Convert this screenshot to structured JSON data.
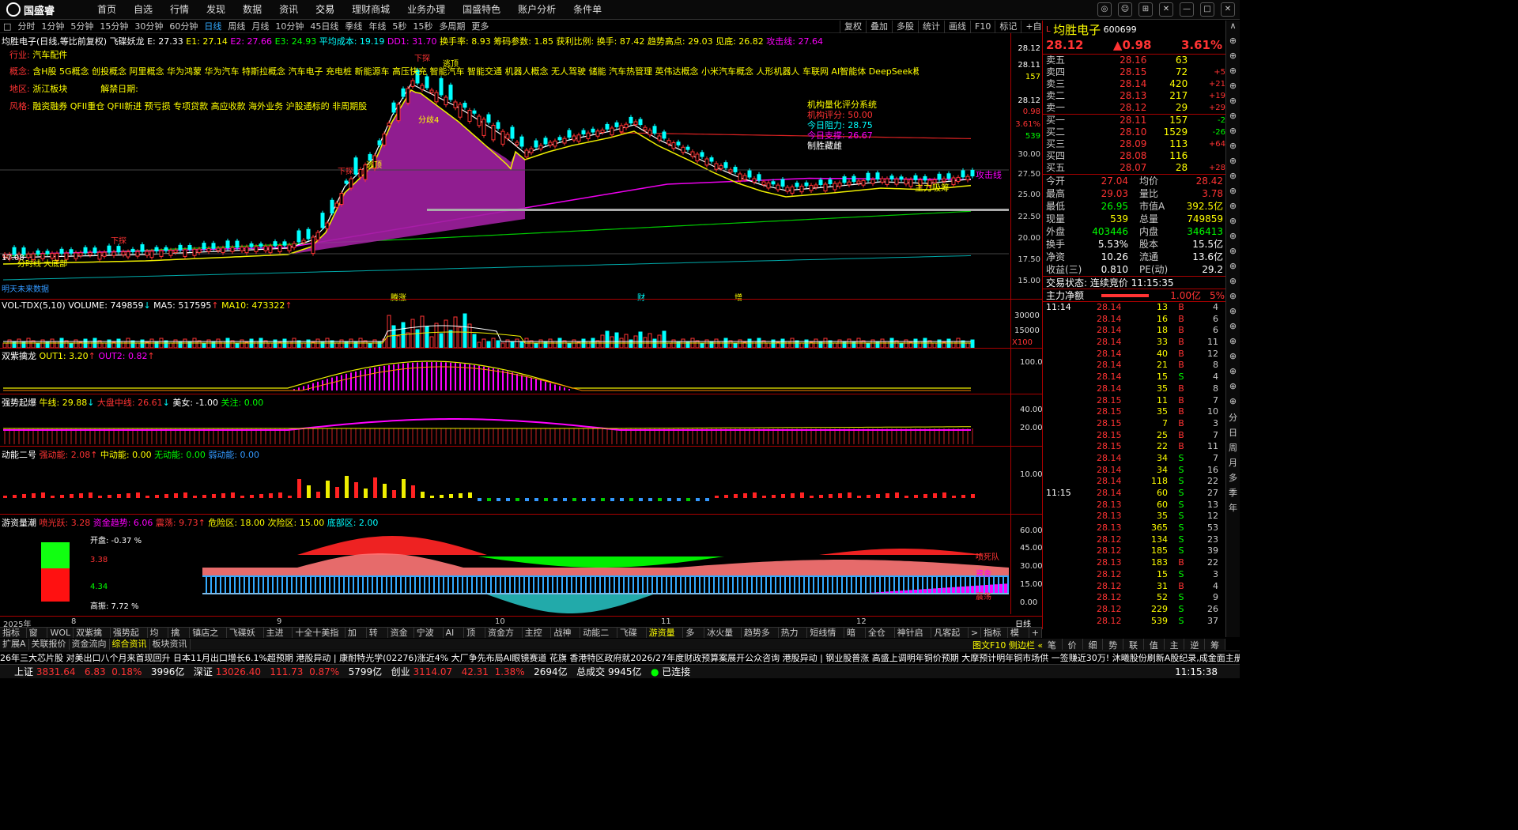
{
  "app": {
    "logo_text": "国盛睿",
    "menu": [
      "首页",
      "自选",
      "行情",
      "发现",
      "数据",
      "资讯",
      "交易",
      "理财商城",
      "业务办理",
      "国盛特色",
      "账户分析",
      "条件单"
    ],
    "window_icons": [
      "chat-icon",
      "user-icon",
      "grid-icon",
      "min",
      "max",
      "close"
    ]
  },
  "period_bar": [
    "□",
    "分时",
    "1分钟",
    "5分钟",
    "15分钟",
    "30分钟",
    "60分钟",
    "日线",
    "周线",
    "月线",
    "10分钟",
    "45日线",
    "季线",
    "年线",
    "5秒",
    "15秒",
    "多周期",
    "更多"
  ],
  "period_selected": "日线",
  "tool_buttons": [
    "复权",
    "叠加",
    "多股",
    "统计",
    "画线",
    "F10",
    "标记",
    "+自选",
    "返回"
  ],
  "main_header": {
    "name": "均胜电子(日线,等比前复权)",
    "indicator": "飞碟妖龙",
    "E": "E: 27.33",
    "E1": "E1: 27.14",
    "E2": "E2: 27.66",
    "E3": "E3: 24.93",
    "avg_cost": "平均成本: 19.19",
    "dd1": "DD1: 31.70",
    "turnover_rate": "换手率: 8.93",
    "chip": "筹码参数: 1.85",
    "profit": "获利比例:",
    "hand": "换手: 87.42",
    "trend_high": "趋势高点: 29.03",
    "low_line": "见底: 26.82",
    "attack": "攻击线: 27.64"
  },
  "stock_info": {
    "industry_label": "行业:",
    "industry": "汽车配件",
    "concept_label": "概念:",
    "concept": "含H股 5G概念 创投概念 阿里概念 华为鸿蒙 华为汽车 特斯拉概念 汽车电子 充电桩 新能源车 高压快充 智能汽车 智能交通 机器人概念 无人驾驶 储能 汽车热管理 英伟达概念 小米汽车概念 人形机器人 车联网 AI智能体 DeepSeek概念",
    "region_label": "地区:",
    "region": "浙江板块",
    "ban_label": "解禁日期:",
    "style_label": "风格:",
    "style": "融资融券 QFII重仓 QFII新进 预亏损 专项贷款 高应收款 海外业务 沪股通标的 非周期股"
  },
  "score_box": {
    "title": "机构量化评分系统",
    "score": "机构评分: 50.00",
    "resist": "今日阻力: 28.75",
    "support": "今日支撑: 26.67",
    "verdict": "制胜藏雌"
  },
  "main_chart_labels": {
    "high_mark": "高点",
    "low_mark": "17.08",
    "breakout": "下探",
    "main_force": "主力吸筹",
    "attack_line": "攻击线",
    "bottom_left": "分时线 大底部",
    "future": "明天未来数据",
    "sub_labels": [
      "腾涨",
      "财",
      "增"
    ],
    "tags": [
      "下探",
      "妖龙",
      "龙",
      "逃顶",
      "分歧4"
    ]
  },
  "price_axis": [
    "28.12",
    "28.11",
    "157",
    "28.12",
    "0.98",
    "3.61%",
    "539",
    "30.00",
    "27.50",
    "25.00",
    "22.50",
    "20.00",
    "17.50",
    "15.00"
  ],
  "vol_header": {
    "name": "VOL-TDX(5,10)",
    "volume": "VOLUME: 749859",
    "ma5": "MA5: 517595",
    "ma10": "MA10: 473322"
  },
  "vol_axis": [
    "30000",
    "15000",
    "X100"
  ],
  "p2_header": {
    "name": "双紫擒龙",
    "out1": "OUT1: 3.20",
    "out2": "OUT2: 0.82"
  },
  "p2_axis": [
    "100.0"
  ],
  "p3_header": {
    "name": "强势起爆",
    "line1": "牛线: 29.88",
    "line2": "大盘中线: 26.61",
    "line3": "美女: -1.00",
    "line4": "关注: 0.00"
  },
  "p3_axis": [
    "40.00",
    "20.00"
  ],
  "p4_header": {
    "name": "动能二号",
    "s1": "强动能: 2.08",
    "s2": "中动能: 0.00",
    "s3": "无动能: 0.00",
    "s4": "弱动能: 0.00"
  },
  "p4_axis": [
    "10.00"
  ],
  "p5_header": {
    "name": "游资量潮",
    "a": "喷光跃: 3.28",
    "b": "资金趋势: 6.06",
    "c": "震荡: 9.73",
    "d": "危险区: 18.00",
    "e": "次险区: 15.00",
    "f": "底部区: 2.00"
  },
  "p5_axis": [
    "60.00",
    "45.00",
    "30.00",
    "15.00",
    "0.00"
  ],
  "p5_box": {
    "open_label": "开盘: -0.37 %",
    "up": "3.38",
    "down": "4.34",
    "high_label": "高振: 7.72 %"
  },
  "p5_right_labels": [
    "喷死队",
    "资金",
    "震荡"
  ],
  "date_axis": [
    "2025年",
    "8",
    "9",
    "10",
    "11",
    "12"
  ],
  "date_axis_right": "日线",
  "quote": {
    "title": "均胜电子",
    "code": "600699",
    "price": "28.12",
    "change": "▲0.98",
    "pct": "3.61%",
    "asks": [
      {
        "l": "卖五",
        "p": "28.16",
        "v": "63",
        "c": ""
      },
      {
        "l": "卖四",
        "p": "28.15",
        "v": "72",
        "c": "+5"
      },
      {
        "l": "卖三",
        "p": "28.14",
        "v": "420",
        "c": "+21"
      },
      {
        "l": "卖二",
        "p": "28.13",
        "v": "217",
        "c": "+19"
      },
      {
        "l": "卖一",
        "p": "28.12",
        "v": "29",
        "c": "+29"
      }
    ],
    "bids": [
      {
        "l": "买一",
        "p": "28.11",
        "v": "157",
        "c": "-2"
      },
      {
        "l": "买二",
        "p": "28.10",
        "v": "1529",
        "c": "-26"
      },
      {
        "l": "买三",
        "p": "28.09",
        "v": "113",
        "c": "+64"
      },
      {
        "l": "买四",
        "p": "28.08",
        "v": "116",
        "c": ""
      },
      {
        "l": "买五",
        "p": "28.07",
        "v": "28",
        "c": "+28"
      }
    ],
    "info": [
      [
        "今开",
        "27.04",
        "均价",
        "28.42"
      ],
      [
        "最高",
        "29.03",
        "量比",
        "3.78"
      ],
      [
        "最低",
        "26.95",
        "市值A",
        "392.5亿"
      ],
      [
        "现量",
        "539",
        "总量",
        "749859"
      ],
      [
        "外盘",
        "403446",
        "内盘",
        "346413"
      ],
      [
        "换手",
        "5.53%",
        "股本",
        "15.5亿"
      ],
      [
        "净资",
        "10.26",
        "流通",
        "13.6亿"
      ],
      [
        "收益(三)",
        "0.810",
        "PE(动)",
        "29.2"
      ]
    ],
    "trade_state": "交易状态: 连续竞价 11:15:35",
    "main_net": "主力净额",
    "main_net_val": "1.00亿",
    "main_net_pct": "5%",
    "ticks_time1": "11:14",
    "ticks_time2": "11:15",
    "ticks": [
      [
        "28.14",
        "13",
        "B",
        "4"
      ],
      [
        "28.14",
        "16",
        "B",
        "6"
      ],
      [
        "28.14",
        "18",
        "B",
        "6"
      ],
      [
        "28.14",
        "33",
        "B",
        "11"
      ],
      [
        "28.14",
        "40",
        "B",
        "12"
      ],
      [
        "28.14",
        "21",
        "B",
        "8"
      ],
      [
        "28.14",
        "15",
        "S",
        "4"
      ],
      [
        "28.14",
        "35",
        "B",
        "8"
      ],
      [
        "28.15",
        "11",
        "B",
        "7"
      ],
      [
        "28.15",
        "35",
        "B",
        "10"
      ],
      [
        "28.15",
        "7",
        "B",
        "3"
      ],
      [
        "28.15",
        "25",
        "B",
        "7"
      ],
      [
        "28.15",
        "22",
        "B",
        "11"
      ],
      [
        "28.14",
        "34",
        "S",
        "7"
      ],
      [
        "28.14",
        "34",
        "S",
        "16"
      ],
      [
        "28.14",
        "118",
        "S",
        "22"
      ],
      [
        "28.14",
        "60",
        "S",
        "27"
      ],
      [
        "28.13",
        "60",
        "S",
        "13"
      ],
      [
        "28.13",
        "35",
        "S",
        "12"
      ],
      [
        "28.13",
        "365",
        "S",
        "53"
      ],
      [
        "28.12",
        "134",
        "S",
        "23"
      ],
      [
        "28.12",
        "185",
        "S",
        "39"
      ],
      [
        "28.13",
        "183",
        "B",
        "22"
      ],
      [
        "28.12",
        "15",
        "S",
        "3"
      ],
      [
        "28.12",
        "31",
        "B",
        "4"
      ],
      [
        "28.12",
        "52",
        "S",
        "9"
      ],
      [
        "28.12",
        "229",
        "S",
        "26"
      ],
      [
        "28.12",
        "539",
        "S",
        "37"
      ]
    ]
  },
  "right_tabs": [
    "笔",
    "价",
    "细",
    "势",
    "联",
    "值",
    "主",
    "逆",
    "筹"
  ],
  "side_nav": [
    "∧",
    "⊕",
    "⊕",
    "⊕",
    "⊕",
    "⊕",
    "⊕",
    "⊕",
    "⊕",
    "⊕",
    "⊕",
    "⊕",
    "⊕",
    "⊕",
    "⊕",
    "⊕",
    "⊕",
    "⊕",
    "⊕",
    "⊕",
    "⊕",
    "⊕",
    "⊕",
    "⊕",
    "⊕",
    "⊕",
    "分",
    "日",
    "周",
    "月",
    "多",
    "季",
    "年"
  ],
  "bottom_tabs1": [
    "指标A",
    "窗口",
    "WOL",
    "双紫擒龙",
    "强势起爆",
    "均线",
    "擒龙",
    "镇店之宝",
    "飞碟妖龙",
    "主进出",
    "十全十美指标",
    "加仓",
    "转点",
    "资金2",
    "宁波帮",
    "AI龙",
    "顶底",
    "资金方向",
    "主控盘",
    "战神号",
    "动能二号",
    "飞碟妖",
    "游资量潮",
    "多空",
    "冰火量能",
    "趋势多空",
    "热力图",
    "短线情绪",
    "暗盘",
    "全仓买",
    "神针启动",
    "凡客起爆",
    ">",
    "指标B",
    "模板",
    "+"
  ],
  "bottom_tabs1_selected": "游资量潮",
  "bottom_tabs2": [
    "扩展A",
    "关联报价",
    "资金流向",
    "综合资讯",
    "板块资讯"
  ],
  "bottom_tabs2_selected": "综合资讯",
  "bottom_tabs2_right": "图文F10 侧边栏 «",
  "ticker": "26年三大芯片股      对美出口八个月来首现回升   日本11月出口增长6.1%超预期        港股异动 | 康耐特光学(02276)涨近4% 大厂争先布局AI眼镜赛道 花旗        香港特区政府就2026/27年度财政预算案展开公众咨询        港股异动 | 钢业股普涨 高盛上调明年铜价预期 大摩预计明年铜市场供      一签赚近30万! 沐曦股份刷新A股纪录,成金面主册制",
  "status": {
    "sh_label": "上证",
    "sh": "3831.64",
    "sh_chg": "6.83",
    "sh_pct": "0.18%",
    "sh_amt": "3996亿",
    "sz_label": "深证",
    "sz": "13026.40",
    "sz_chg": "111.73",
    "sz_pct": "0.87%",
    "sz_amt": "5799亿",
    "cy_label": "创业",
    "cy": "3114.07",
    "cy_chg": "42.31",
    "cy_pct": "1.38%",
    "cy_amt": "2694亿",
    "total_label": "总成交",
    "total": "9945亿",
    "conn": "已连接",
    "time": "11:15:38"
  },
  "colors": {
    "up": "#ff3333",
    "down": "#00ffff",
    "bg": "#000000",
    "border": "#aa0000",
    "accent": "#ffff00"
  },
  "chart_data": {
    "type": "candlestick",
    "series": [
      {
        "name": "飞碟妖龙"
      }
    ]
  }
}
